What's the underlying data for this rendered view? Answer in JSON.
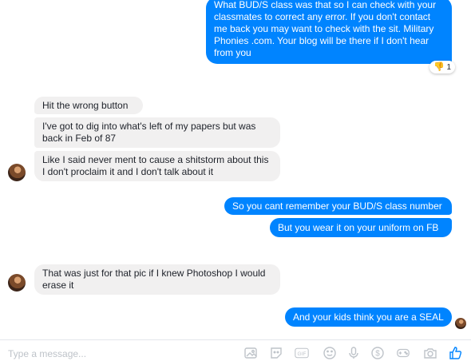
{
  "thread": {
    "messages": [
      {
        "side": "out",
        "text": "What BUD/S class was that so I can check with your classmates to correct any error. If you don't contact me back you may want to check with the sit. Military Phonies .com. Your blog will be there if I don't hear from you"
      },
      {
        "side": "in",
        "text": "Hit the wrong button"
      },
      {
        "side": "in",
        "text": "I've got to dig into what's left of my papers but was back in Feb of 87"
      },
      {
        "side": "in",
        "text": "Like I said never ment to cause a shitstorm about this I don't proclaim it and I don't talk about it"
      },
      {
        "side": "out",
        "text": "So you cant remember your BUD/S class number"
      },
      {
        "side": "out",
        "text": "But you wear it on your uniform on FB"
      },
      {
        "side": "in",
        "text": "That was just for that pic if I knew Photoshop I would erase it"
      },
      {
        "side": "out",
        "text": "And your kids think you are a SEAL"
      }
    ],
    "reaction": {
      "emoji": "thumbs-down",
      "glyph": "👎",
      "count": "1"
    }
  },
  "composer": {
    "placeholder": "Type a message...",
    "tools": [
      "photo-icon",
      "sticker-icon",
      "gif-icon",
      "emoji-icon",
      "microphone-icon",
      "payment-icon",
      "game-icon",
      "camera-icon",
      "like-icon"
    ],
    "accent": "#0084ff"
  },
  "colors": {
    "outgoing": "#0084ff",
    "incoming": "#f1f0f0"
  }
}
